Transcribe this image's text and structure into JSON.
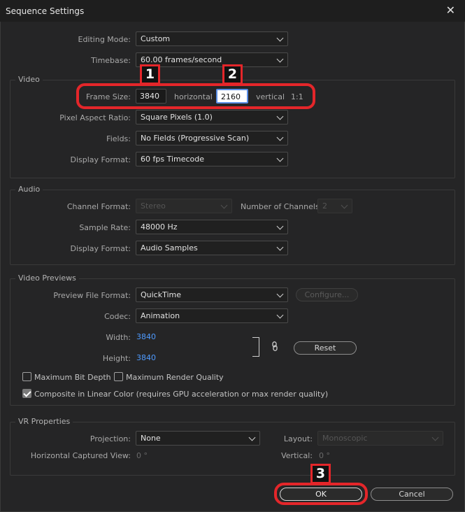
{
  "window": {
    "title": "Sequence Settings"
  },
  "general": {
    "editing_mode": {
      "label": "Editing Mode:",
      "value": "Custom"
    },
    "timebase": {
      "label": "Timebase:",
      "value": "60.00  frames/second"
    }
  },
  "video": {
    "title": "Video",
    "frame_size": {
      "label": "Frame Size:",
      "horizontal": "3840",
      "horizontal_label": "horizontal",
      "vertical": "2160",
      "vertical_label": "vertical",
      "ratio": "1:1"
    },
    "pixel_aspect_ratio": {
      "label": "Pixel Aspect Ratio:",
      "value": "Square Pixels (1.0)"
    },
    "fields": {
      "label": "Fields:",
      "value": "No Fields (Progressive Scan)"
    },
    "display_format": {
      "label": "Display Format:",
      "value": "60 fps Timecode"
    }
  },
  "audio": {
    "title": "Audio",
    "channel_format": {
      "label": "Channel Format:",
      "value": "Stereo"
    },
    "number_of_channels": {
      "label": "Number of Channels:",
      "value": "2"
    },
    "sample_rate": {
      "label": "Sample Rate:",
      "value": "48000 Hz"
    },
    "display_format": {
      "label": "Display Format:",
      "value": "Audio Samples"
    }
  },
  "video_previews": {
    "title": "Video Previews",
    "preview_file_format": {
      "label": "Preview File Format:",
      "value": "QuickTime"
    },
    "configure_button": "Configure...",
    "codec": {
      "label": "Codec:",
      "value": "Animation"
    },
    "width": {
      "label": "Width:",
      "value": "3840"
    },
    "height": {
      "label": "Height:",
      "value": "3840"
    },
    "reset_button": "Reset",
    "max_bit_depth": {
      "label": "Maximum Bit Depth",
      "checked": false
    },
    "max_render_quality": {
      "label": "Maximum Render Quality",
      "checked": false
    },
    "composite_linear": {
      "label": "Composite in Linear Color (requires GPU acceleration or max render quality)",
      "checked": true
    }
  },
  "vr_properties": {
    "title": "VR Properties",
    "projection": {
      "label": "Projection:",
      "value": "None"
    },
    "layout": {
      "label": "Layout:",
      "value": "Monoscopic"
    },
    "horizontal_captured_view": {
      "label": "Horizontal Captured View:",
      "value": "0 °"
    },
    "vertical": {
      "label": "Vertical:",
      "value": "0 °"
    }
  },
  "buttons": {
    "ok": "OK",
    "cancel": "Cancel"
  },
  "annotations": {
    "callout_1": "1",
    "callout_2": "2",
    "callout_3": "3"
  },
  "colors": {
    "highlight_red": "#e4262a",
    "link_blue": "#4f9bff",
    "background": "#252526"
  }
}
